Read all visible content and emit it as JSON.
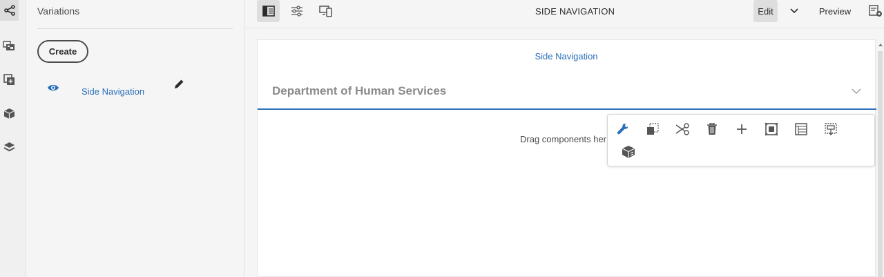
{
  "panel": {
    "title": "Variations",
    "create_label": "Create",
    "variations": [
      {
        "label": "Side Navigation",
        "icon": "eye-icon",
        "action_icon": "pencil-icon"
      }
    ]
  },
  "rail": {
    "icons": [
      "share-tree-icon",
      "assets-icon",
      "add-component-icon",
      "component-cube-icon",
      "layers-icon"
    ]
  },
  "toolbar": {
    "icons": [
      "toggle-side-panel-icon",
      "properties-sliders-icon",
      "emulator-devices-icon"
    ],
    "title": "SIDE NAVIGATION",
    "edit_label": "Edit",
    "preview_label": "Preview",
    "page-info-icon": "page-info-icon"
  },
  "canvas": {
    "heading": "Side Navigation",
    "department": "Department of Human Services",
    "drag_hint": "Drag components her"
  },
  "component_toolbar": {
    "icons": [
      "configure-wrench-icon",
      "copy-icon",
      "cut-scissors-icon",
      "delete-trash-icon",
      "insert-plus-icon",
      "select-parent-icon",
      "layout-icon",
      "group-icon",
      "convert-component-icon"
    ]
  },
  "colors": {
    "accent": "#2a6fb9",
    "muted_heading": "#8a8a8a",
    "background": "#f5f5f5"
  }
}
